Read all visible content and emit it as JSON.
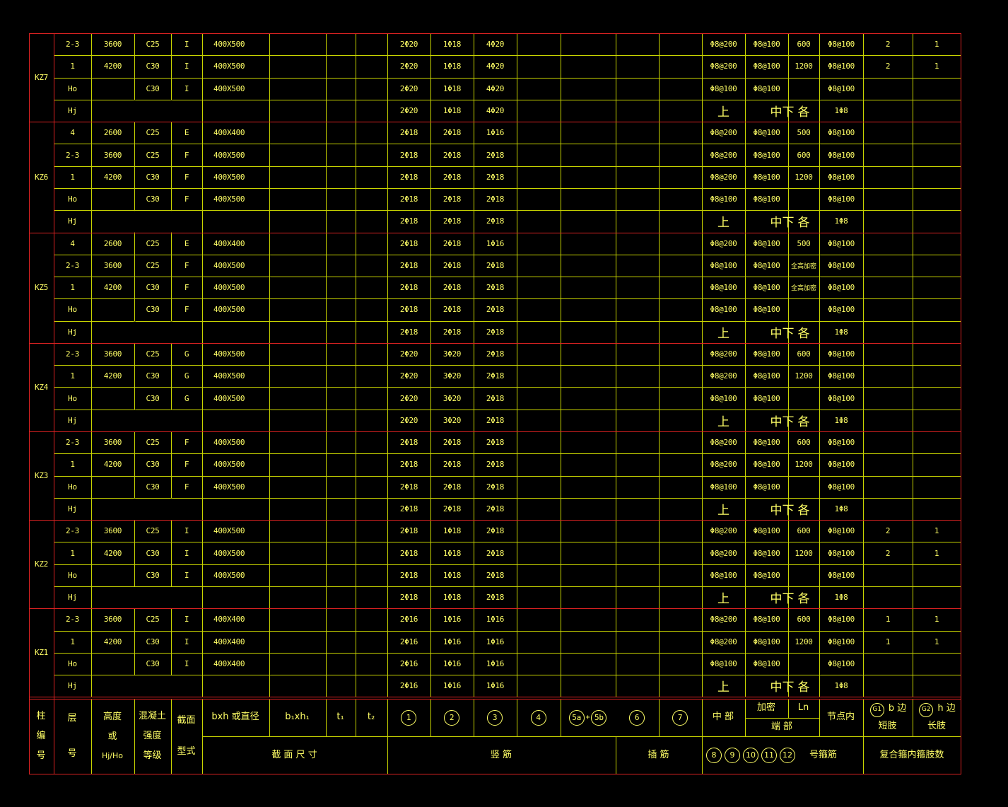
{
  "colors": {
    "background": "#000000",
    "outer_border": "#dd2222",
    "grid": "#c8d400",
    "text": "#ffff66"
  },
  "columns": {
    "num_row": [
      "KZ7",
      "KZ6",
      "KZ5",
      "KZ4",
      "KZ3",
      "KZ2",
      "KZ1"
    ]
  },
  "groups": [
    {
      "id": "KZ7",
      "rows": [
        [
          "2-3",
          "3600",
          "C25",
          "I",
          "400X500",
          "2Φ20",
          "1Φ18",
          "4Φ20",
          "Φ8@200",
          "Φ8@100",
          "600",
          "Φ8@100",
          "2",
          "1"
        ],
        [
          "1",
          "4200",
          "C30",
          "I",
          "400X500",
          "2Φ20",
          "1Φ18",
          "4Φ20",
          "Φ8@200",
          "Φ8@100",
          "1200",
          "Φ8@100",
          "2",
          "1"
        ],
        [
          "Ho",
          "",
          "C30",
          "I",
          "400X500",
          "2Φ20",
          "1Φ18",
          "4Φ20",
          "Φ8@100",
          "Φ8@100",
          "",
          "Φ8@100",
          "",
          ""
        ],
        [
          "Hj",
          "",
          "",
          "",
          "",
          "2Φ20",
          "1Φ18",
          "4Φ20",
          "上",
          "中下",
          "各",
          "1Φ8",
          "",
          ""
        ]
      ]
    },
    {
      "id": "KZ6",
      "rows": [
        [
          "4",
          "2600",
          "C25",
          "E",
          "400X400",
          "2Φ18",
          "2Φ18",
          "1Φ16",
          "Φ8@200",
          "Φ8@100",
          "500",
          "Φ8@100",
          "",
          ""
        ],
        [
          "2-3",
          "3600",
          "C25",
          "F",
          "400X500",
          "2Φ18",
          "2Φ18",
          "2Φ18",
          "Φ8@200",
          "Φ8@100",
          "600",
          "Φ8@100",
          "",
          ""
        ],
        [
          "1",
          "4200",
          "C30",
          "F",
          "400X500",
          "2Φ18",
          "2Φ18",
          "2Φ18",
          "Φ8@200",
          "Φ8@100",
          "1200",
          "Φ8@100",
          "",
          ""
        ],
        [
          "Ho",
          "",
          "C30",
          "F",
          "400X500",
          "2Φ18",
          "2Φ18",
          "2Φ18",
          "Φ8@100",
          "Φ8@100",
          "",
          "Φ8@100",
          "",
          ""
        ],
        [
          "Hj",
          "",
          "",
          "",
          "",
          "2Φ18",
          "2Φ18",
          "2Φ18",
          "上",
          "中下",
          "各",
          "1Φ8",
          "",
          ""
        ]
      ]
    },
    {
      "id": "KZ5",
      "rows": [
        [
          "4",
          "2600",
          "C25",
          "E",
          "400X400",
          "2Φ18",
          "2Φ18",
          "1Φ16",
          "Φ8@200",
          "Φ8@100",
          "500",
          "Φ8@100",
          "",
          ""
        ],
        [
          "2-3",
          "3600",
          "C25",
          "F",
          "400X500",
          "2Φ18",
          "2Φ18",
          "2Φ18",
          "Φ8@100",
          "Φ8@100",
          "全高加密",
          "Φ8@100",
          "",
          ""
        ],
        [
          "1",
          "4200",
          "C30",
          "F",
          "400X500",
          "2Φ18",
          "2Φ18",
          "2Φ18",
          "Φ8@100",
          "Φ8@100",
          "全高加密",
          "Φ8@100",
          "",
          ""
        ],
        [
          "Ho",
          "",
          "C30",
          "F",
          "400X500",
          "2Φ18",
          "2Φ18",
          "2Φ18",
          "Φ8@100",
          "Φ8@100",
          "",
          "Φ8@100",
          "",
          ""
        ],
        [
          "Hj",
          "",
          "",
          "",
          "",
          "2Φ18",
          "2Φ18",
          "2Φ18",
          "上",
          "中下",
          "各",
          "1Φ8",
          "",
          ""
        ]
      ]
    },
    {
      "id": "KZ4",
      "rows": [
        [
          "2-3",
          "3600",
          "C25",
          "G",
          "400X500",
          "2Φ20",
          "3Φ20",
          "2Φ18",
          "Φ8@200",
          "Φ8@100",
          "600",
          "Φ8@100",
          "",
          ""
        ],
        [
          "1",
          "4200",
          "C30",
          "G",
          "400X500",
          "2Φ20",
          "3Φ20",
          "2Φ18",
          "Φ8@200",
          "Φ8@100",
          "1200",
          "Φ8@100",
          "",
          ""
        ],
        [
          "Ho",
          "",
          "C30",
          "G",
          "400X500",
          "2Φ20",
          "3Φ20",
          "2Φ18",
          "Φ8@100",
          "Φ8@100",
          "",
          "Φ8@100",
          "",
          ""
        ],
        [
          "Hj",
          "",
          "",
          "",
          "",
          "2Φ20",
          "3Φ20",
          "2Φ18",
          "上",
          "中下",
          "各",
          "1Φ8",
          "",
          ""
        ]
      ]
    },
    {
      "id": "KZ3",
      "rows": [
        [
          "2-3",
          "3600",
          "C25",
          "F",
          "400X500",
          "2Φ18",
          "2Φ18",
          "2Φ18",
          "Φ8@200",
          "Φ8@100",
          "600",
          "Φ8@100",
          "",
          ""
        ],
        [
          "1",
          "4200",
          "C30",
          "F",
          "400X500",
          "2Φ18",
          "2Φ18",
          "2Φ18",
          "Φ8@200",
          "Φ8@100",
          "1200",
          "Φ8@100",
          "",
          ""
        ],
        [
          "Ho",
          "",
          "C30",
          "F",
          "400X500",
          "2Φ18",
          "2Φ18",
          "2Φ18",
          "Φ8@100",
          "Φ8@100",
          "",
          "Φ8@100",
          "",
          ""
        ],
        [
          "Hj",
          "",
          "",
          "",
          "",
          "2Φ18",
          "2Φ18",
          "2Φ18",
          "上",
          "中下",
          "各",
          "1Φ8",
          "",
          ""
        ]
      ]
    },
    {
      "id": "KZ2",
      "rows": [
        [
          "2-3",
          "3600",
          "C25",
          "I",
          "400X500",
          "2Φ18",
          "1Φ18",
          "2Φ18",
          "Φ8@200",
          "Φ8@100",
          "600",
          "Φ8@100",
          "2",
          "1"
        ],
        [
          "1",
          "4200",
          "C30",
          "I",
          "400X500",
          "2Φ18",
          "1Φ18",
          "2Φ18",
          "Φ8@200",
          "Φ8@100",
          "1200",
          "Φ8@100",
          "2",
          "1"
        ],
        [
          "Ho",
          "",
          "C30",
          "I",
          "400X500",
          "2Φ18",
          "1Φ18",
          "2Φ18",
          "Φ8@100",
          "Φ8@100",
          "",
          "Φ8@100",
          "",
          ""
        ],
        [
          "Hj",
          "",
          "",
          "",
          "",
          "2Φ18",
          "1Φ18",
          "2Φ18",
          "上",
          "中下",
          "各",
          "1Φ8",
          "",
          ""
        ]
      ]
    },
    {
      "id": "KZ1",
      "rows": [
        [
          "2-3",
          "3600",
          "C25",
          "I",
          "400X400",
          "2Φ16",
          "1Φ16",
          "1Φ16",
          "Φ8@200",
          "Φ8@100",
          "600",
          "Φ8@100",
          "1",
          "1"
        ],
        [
          "1",
          "4200",
          "C30",
          "I",
          "400X400",
          "2Φ16",
          "1Φ16",
          "1Φ16",
          "Φ8@200",
          "Φ8@100",
          "1200",
          "Φ8@100",
          "1",
          "1"
        ],
        [
          "Ho",
          "",
          "C30",
          "I",
          "400X400",
          "2Φ16",
          "1Φ16",
          "1Φ16",
          "Φ8@100",
          "Φ8@100",
          "",
          "Φ8@100",
          "",
          ""
        ],
        [
          "Hj",
          "",
          "",
          "",
          "",
          "2Φ16",
          "1Φ16",
          "1Φ16",
          "上",
          "中下",
          "各",
          "1Φ8",
          "",
          ""
        ]
      ]
    }
  ],
  "header": {
    "col_num": [
      "柱",
      "编",
      "号"
    ],
    "col_floor": [
      "层",
      "号"
    ],
    "col_height": [
      "高度",
      "或",
      "Hj/Ho"
    ],
    "col_concrete": [
      "混凝土",
      "强度",
      "等级"
    ],
    "col_type": [
      "截面",
      "型式"
    ],
    "sec_bxh": "bxh    或直径",
    "sec_b1h1": "b₁xh₁",
    "sec_t1": "t₁",
    "sec_t2": "t₂",
    "sec_title": "截 面 尺 寸",
    "bar_1": "1",
    "bar_2": "2",
    "bar_3": "3",
    "bar_4": "4",
    "bar_5a": "5a",
    "bar_plus": "+",
    "bar_5b": "5b",
    "bar_6": "6",
    "bar_7": "7",
    "bar_title": "竖          筋",
    "insert_title": "插  筋",
    "stir_mid": "中 部",
    "stir_dense": "加密",
    "stir_ln": "Ln",
    "stir_end": "端   部",
    "stir_joint": "节点内",
    "stir_nums": [
      "8",
      "9",
      "10",
      "11",
      "12"
    ],
    "stir_title": "号箍筋",
    "leg_g1": "G1",
    "leg_b": "b 边",
    "leg_short": "短肢",
    "leg_g2": "G2",
    "leg_h": "h 边",
    "leg_long": "长肢",
    "leg_title": "复合箍内箍肢数"
  }
}
